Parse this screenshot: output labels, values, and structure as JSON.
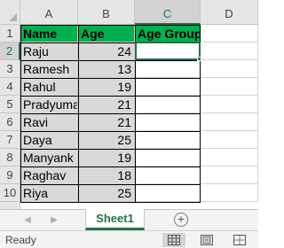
{
  "columns": [
    "A",
    "B",
    "C",
    "D"
  ],
  "rows": [
    "1",
    "2",
    "3",
    "4",
    "5",
    "6",
    "7",
    "8",
    "9",
    "10"
  ],
  "table": {
    "headers": [
      "Name",
      "Age",
      "Age Group"
    ],
    "data": [
      {
        "name": "Raju",
        "age": "24",
        "group": ""
      },
      {
        "name": "Ramesh",
        "age": "13",
        "group": ""
      },
      {
        "name": "Rahul",
        "age": "19",
        "group": ""
      },
      {
        "name": "Pradyuman",
        "age": "21",
        "group": ""
      },
      {
        "name": "Ravi",
        "age": "21",
        "group": ""
      },
      {
        "name": "Daya",
        "age": "25",
        "group": ""
      },
      {
        "name": "Manyank",
        "age": "19",
        "group": ""
      },
      {
        "name": "Raghav",
        "age": "18",
        "group": ""
      },
      {
        "name": "Riya",
        "age": "25",
        "group": ""
      }
    ]
  },
  "selected_cell": "C2",
  "sheet_tabs": [
    {
      "label": "Sheet1",
      "active": true
    }
  ],
  "status": {
    "text": "Ready"
  },
  "icons": {
    "nav_left": "chevron-left-icon",
    "nav_right": "chevron-right-icon",
    "add_sheet": "plus-circle-icon",
    "normal_view": "normal-view-icon",
    "page_layout_view": "page-layout-view-icon",
    "page_break_view": "page-break-view-icon"
  },
  "colors": {
    "header_fill": "#00b050",
    "data_fill": "#d9d9d9",
    "selection": "#217346"
  }
}
